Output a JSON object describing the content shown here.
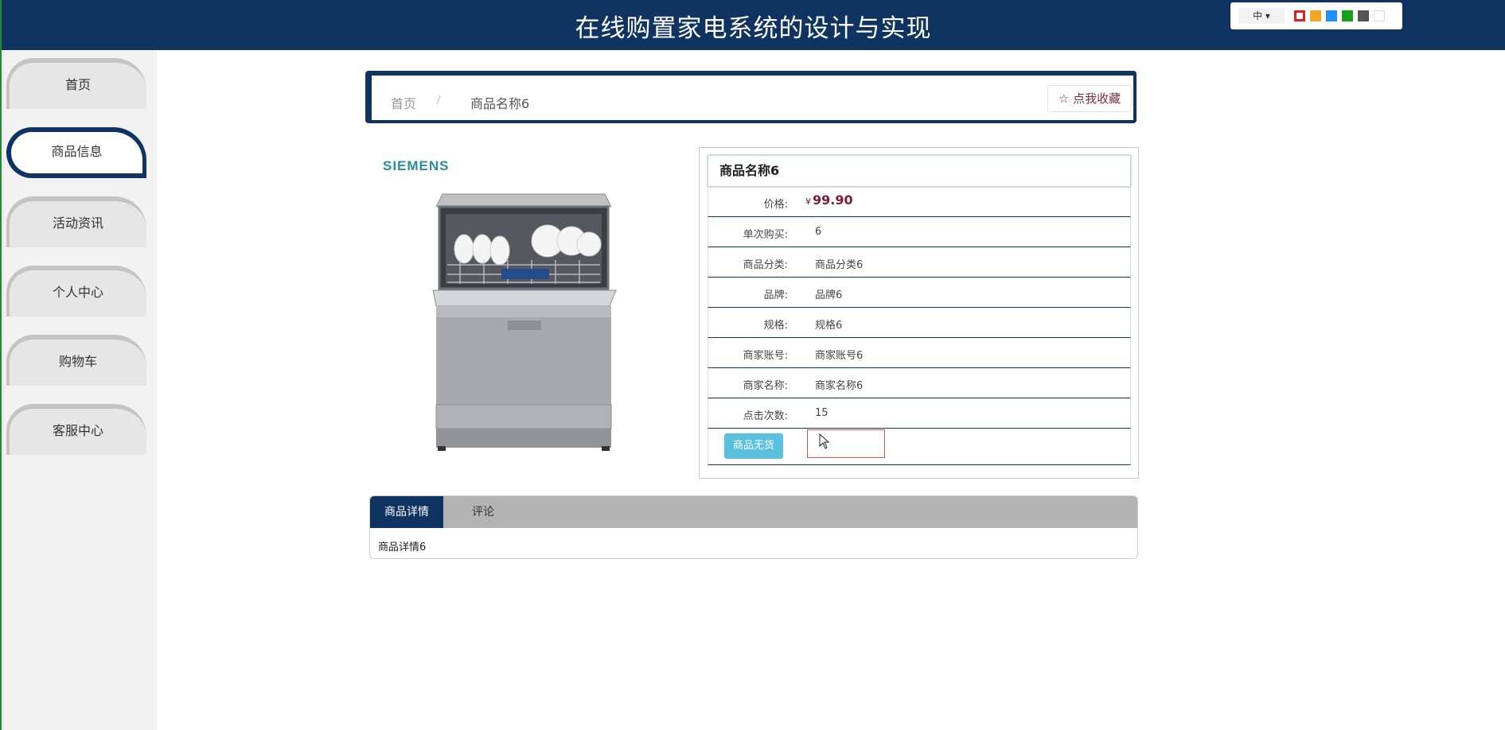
{
  "header": {
    "title": "在线购置家电系统的设计与实现",
    "language": "中",
    "theme_colors": [
      "#e02020",
      "#f5a623",
      "#1e90ff",
      "#18a018",
      "#555555",
      "#ffffff"
    ]
  },
  "sidebar": {
    "items": [
      {
        "label": "首页",
        "active": false
      },
      {
        "label": "商品信息",
        "active": true
      },
      {
        "label": "活动资讯",
        "active": false
      },
      {
        "label": "个人中心",
        "active": false
      },
      {
        "label": "购物车",
        "active": false
      },
      {
        "label": "客服中心",
        "active": false
      }
    ]
  },
  "breadcrumb": {
    "home": "首页",
    "separator": "/",
    "current": "商品名称6",
    "favorite_label": "☆ 点我收藏"
  },
  "product": {
    "brand_logo": "SIEMENS",
    "name": "商品名称6",
    "price_label": "价格:",
    "currency": "¥",
    "price": "99.90",
    "fields": [
      {
        "label": "单次购买:",
        "value": "6"
      },
      {
        "label": "商品分类:",
        "value": "商品分类6"
      },
      {
        "label": "品牌:",
        "value": "品牌6"
      },
      {
        "label": "规格:",
        "value": "规格6"
      },
      {
        "label": "商家账号:",
        "value": "商家账号6"
      },
      {
        "label": "商家名称:",
        "value": "商家名称6"
      },
      {
        "label": "点击次数:",
        "value": "15"
      }
    ],
    "out_of_stock_label": "商品无货",
    "quantity_value": ""
  },
  "tabs": {
    "items": [
      "商品详情",
      "评论"
    ],
    "content": "商品详情6"
  }
}
